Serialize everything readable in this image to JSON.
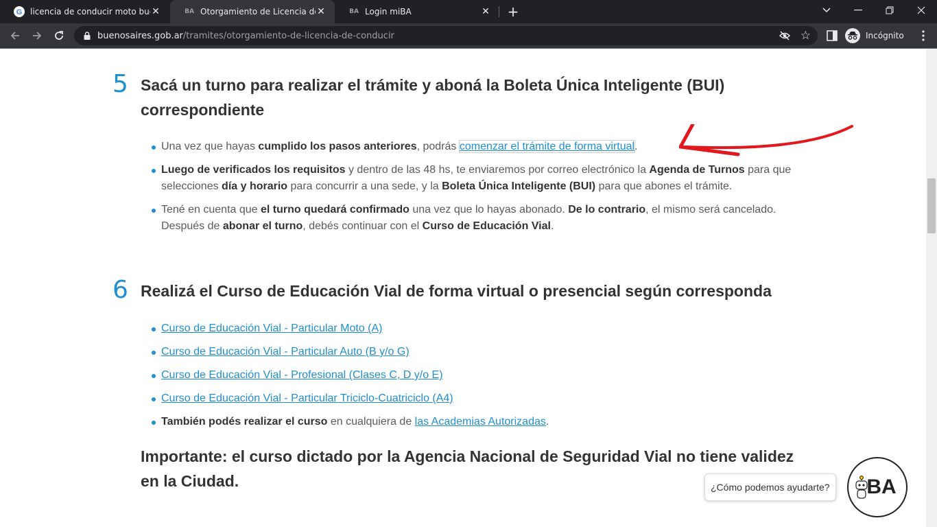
{
  "browser": {
    "tabs": [
      {
        "title": "licencia de conducir moto buenos aires",
        "favicon": "google-icon",
        "active": false
      },
      {
        "title": "Otorgamiento de Licencia de Conducir",
        "favicon": "ba-icon",
        "active": true
      },
      {
        "title": "Login miBA",
        "favicon": "ba-icon",
        "active": false
      }
    ],
    "url_domain": "buenosaires.gob.ar",
    "url_path": "/tramites/otorgamiento-de-licencia-de-conducir",
    "profile_label": "Incógnito"
  },
  "step5": {
    "number": "5",
    "title": "Sacá un turno para realizar el trámite y aboná la Boleta Única Inteligente (BUI) correspondiente",
    "items": [
      {
        "p1": "Una vez que hayas ",
        "b1": "cumplido los pasos anteriores",
        "p2": ", podrás ",
        "link": "comenzar el trámite de forma virtual",
        "p3": "."
      },
      {
        "b1": "Luego de verificados los requisitos",
        "p1": " y dentro de las 48 hs, te enviaremos por correo electrónico la ",
        "b2": "Agenda de Turnos",
        "p2": " para que selecciones ",
        "b3": "día y horario",
        "p3": " para concurrir a una sede, y la ",
        "b4": "Boleta Única Inteligente (BUI)",
        "p4": " para que abones el trámite."
      },
      {
        "p1": "Tené en cuenta que ",
        "b1": "el turno quedará confirmado",
        "p2": " una vez que lo hayas abonado. ",
        "b2": "De lo contrario",
        "p3": ", el mismo será cancelado. Después de ",
        "b3": "abonar el turno",
        "p4": ", debés continuar con el ",
        "b4": "Curso de Educación Vial",
        "p5": "."
      }
    ]
  },
  "step6": {
    "number": "6",
    "title": "Realizá el Curso de Educación Vial de forma virtual o presencial según corresponda",
    "links": [
      "Curso de Educación Vial - Particular Moto (A)",
      "Curso de Educación Vial - Particular Auto (B y/o G)",
      "Curso de Educación Vial - Profesional (Clases C, D y/o E)",
      "Curso de Educación Vial - Particular Triciclo-Cuatriciclo (A4)"
    ],
    "last_item": {
      "b1": "También podés realizar el curso",
      "p1": " en cualquiera de ",
      "link": "las Academias Autorizadas",
      "p2": "."
    }
  },
  "important": "Importante: el curso dictado por la Agencia Nacional de Seguridad Vial no tiene validez en la Ciudad.",
  "chat": {
    "prompt": "¿Cómo podemos ayudarte?",
    "logo_text": "BA"
  },
  "colors": {
    "accent": "#1f8fd1",
    "annotation_arrow": "#e3181f"
  }
}
